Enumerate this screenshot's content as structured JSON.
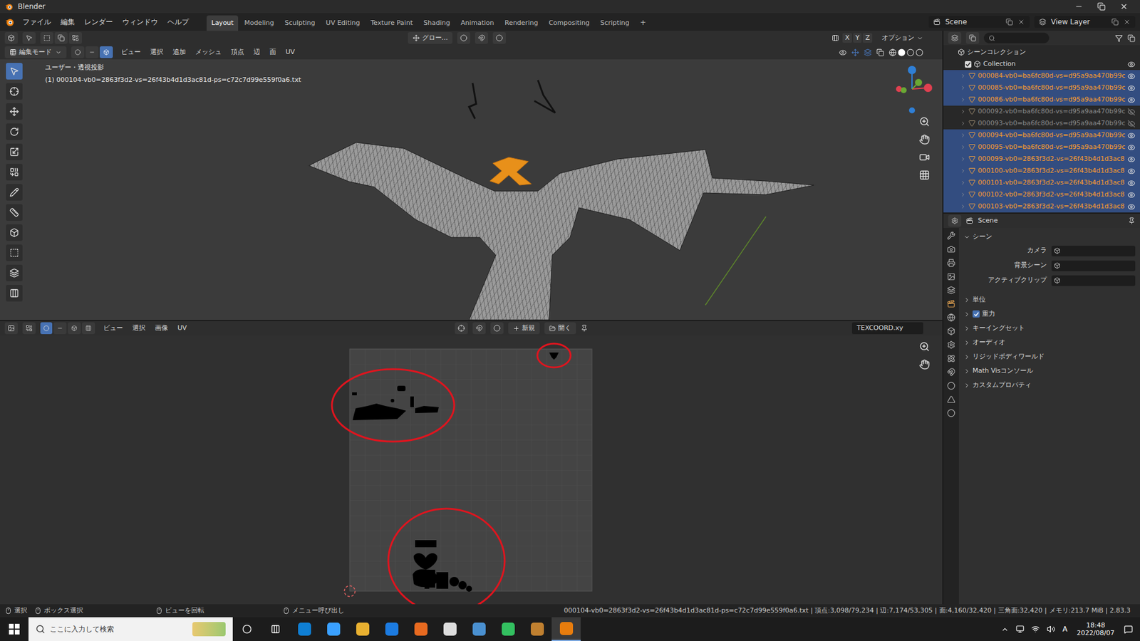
{
  "window": {
    "title": "Blender"
  },
  "menu": [
    "ファイル",
    "編集",
    "レンダー",
    "ウィンドウ",
    "ヘルプ"
  ],
  "workspaces": [
    {
      "label": "Layout",
      "selected": true
    },
    {
      "label": "Modeling",
      "selected": false
    },
    {
      "label": "Sculpting",
      "selected": false
    },
    {
      "label": "UV Editing",
      "selected": false
    },
    {
      "label": "Texture Paint",
      "selected": false
    },
    {
      "label": "Shading",
      "selected": false
    },
    {
      "label": "Animation",
      "selected": false
    },
    {
      "label": "Rendering",
      "selected": false
    },
    {
      "label": "Compositing",
      "selected": false
    },
    {
      "label": "Scripting",
      "selected": false
    }
  ],
  "add_workspace": "+",
  "scene": "Scene",
  "view_layer": "View Layer",
  "viewport": {
    "orientation": "グロー...",
    "axes": [
      "X",
      "Y",
      "Z"
    ],
    "options": "オプション",
    "mode": "編集モード",
    "menus": [
      "ビュー",
      "選択",
      "追加",
      "メッシュ",
      "頂点",
      "辺",
      "面",
      "UV"
    ],
    "view_name": "ユーザー・透視投影",
    "object_info": "(1) 000104-vb0=2863f3d2-vs=26f43b4d1d3ac81d-ps=c72c7d99e559f0a6.txt"
  },
  "uv_editor": {
    "menus": [
      "ビュー",
      "選択",
      "画像",
      "UV"
    ],
    "new": "新規",
    "open": "開く",
    "uv_map": "TEXCOORD.xy"
  },
  "outliner": {
    "root": "シーンコレクション",
    "collection": {
      "name": "Collection",
      "checked": true
    },
    "items": [
      {
        "name": "000084-vb0=ba6fc80d-vs=d95a9aa470b99c",
        "selected": true,
        "visible": true
      },
      {
        "name": "000085-vb0=ba6fc80d-vs=d95a9aa470b99c",
        "selected": true,
        "visible": true
      },
      {
        "name": "000086-vb0=ba6fc80d-vs=d95a9aa470b99c",
        "selected": true,
        "visible": true
      },
      {
        "name": "000092-vb0=ba6fc80d-vs=d95a9aa470b99c",
        "selected": false,
        "visible": false
      },
      {
        "name": "000093-vb0=ba6fc80d-vs=d95a9aa470b99c",
        "selected": false,
        "visible": false
      },
      {
        "name": "000094-vb0=ba6fc80d-vs=d95a9aa470b99c",
        "selected": true,
        "visible": true
      },
      {
        "name": "000095-vb0=ba6fc80d-vs=d95a9aa470b99c",
        "selected": true,
        "visible": true
      },
      {
        "name": "000099-vb0=2863f3d2-vs=26f43b4d1d3ac8",
        "selected": true,
        "visible": true
      },
      {
        "name": "000100-vb0=2863f3d2-vs=26f43b4d1d3ac8",
        "selected": true,
        "visible": true
      },
      {
        "name": "000101-vb0=2863f3d2-vs=26f43b4d1d3ac8",
        "selected": true,
        "visible": true
      },
      {
        "name": "000102-vb0=2863f3d2-vs=26f43b4d1d3ac8",
        "selected": true,
        "visible": true
      },
      {
        "name": "000103-vb0=2863f3d2-vs=26f43b4d1d3ac8",
        "selected": true,
        "visible": true
      }
    ]
  },
  "properties": {
    "context": "Scene",
    "panel": {
      "title": "シーン",
      "expanded": true,
      "fields": [
        {
          "label": "カメラ"
        },
        {
          "label": "背景シーン"
        },
        {
          "label": "アクティブクリップ"
        }
      ]
    },
    "sections": [
      {
        "label": "単位",
        "kind": "plain",
        "expanded": false
      },
      {
        "label": "重力",
        "kind": "checkbox",
        "checked": true,
        "expanded": false
      },
      {
        "label": "キーイングセット",
        "kind": "plain",
        "expanded": false
      },
      {
        "label": "オーディオ",
        "kind": "plain",
        "expanded": false
      },
      {
        "label": "リジッドボディワールド",
        "kind": "plain",
        "expanded": false
      },
      {
        "label": "Math Visコンソール",
        "kind": "plain",
        "expanded": false
      },
      {
        "label": "カスタムプロパティ",
        "kind": "plain",
        "expanded": false
      }
    ]
  },
  "status_bar": {
    "hints": [
      "選択",
      "ボックス選択",
      "ビューを回転",
      "メニュー呼び出し"
    ],
    "stats": "000104-vb0=2863f3d2-vs=26f43b4d1d3ac81d-ps=c72c7d99e559f0a6.txt | 頂点:3,098/79,234 | 辺:7,174/53,305 | 面:4,160/32,420 | 三角面:32,420 | メモリ:213.7 MiB | 2.83.3"
  },
  "taskbar": {
    "search_placeholder": "ここに入力して検索",
    "ime": "A",
    "time": "18:48",
    "date": "2022/08/07"
  }
}
